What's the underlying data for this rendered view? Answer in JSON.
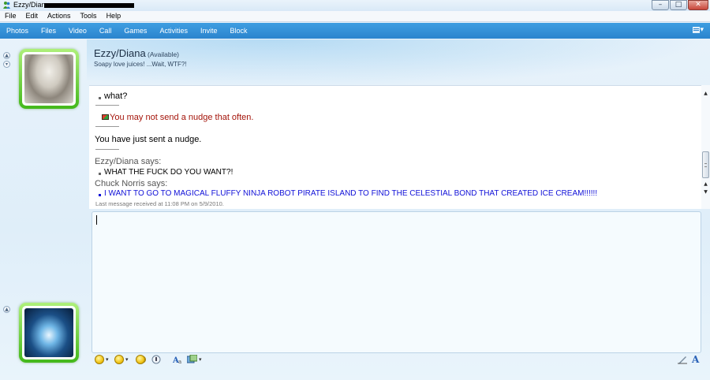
{
  "window": {
    "title": "Ezzy/Diana",
    "controls": {
      "minimize": "–",
      "maximize": "□",
      "close": "✕"
    }
  },
  "menu": [
    "File",
    "Edit",
    "Actions",
    "Tools",
    "Help"
  ],
  "toolbar": {
    "items": [
      "Photos",
      "Files",
      "Video",
      "Call",
      "Games",
      "Activities",
      "Invite",
      "Block"
    ],
    "options_glyph": "▾"
  },
  "contact": {
    "name": "Ezzy/Diana",
    "status": "(Available)",
    "personal_message": "Soapy love juices! ...Wait, WTF?!"
  },
  "conversation": {
    "messages": [
      {
        "type": "bullet",
        "text": "what?"
      },
      {
        "type": "notice",
        "text": "You may not send a nudge that often."
      },
      {
        "type": "plain",
        "text": "You have just sent a nudge."
      },
      {
        "type": "sender",
        "text": "Ezzy/Diana says:"
      },
      {
        "type": "bullet",
        "text": "WHAT THE FUCK DO YOU WANT?!"
      },
      {
        "type": "sender",
        "text": "Chuck Norris says:"
      },
      {
        "type": "bullet-blue",
        "text": "I WANT TO GO TO MAGICAL FLUFFY NINJA ROBOT PIRATE ISLAND TO FIND THE CELESTIAL BOND THAT CREATED ICE CREAM!!!!!!"
      }
    ],
    "last_received": "Last message received at 11:08 PM on 5/9/2010."
  },
  "input": {
    "value": ""
  },
  "colors": {
    "accent_toolbar": "#2b84ce",
    "avatar_frame": "#43b81b",
    "my_text": "#1010d8",
    "notice_text": "#a4140a"
  },
  "icons": [
    "emoticon-icon",
    "wink-icon",
    "nudge-icon",
    "voice-clip-icon",
    "font-icon",
    "background-icon",
    "handwriting-icon",
    "text-format-icon"
  ]
}
